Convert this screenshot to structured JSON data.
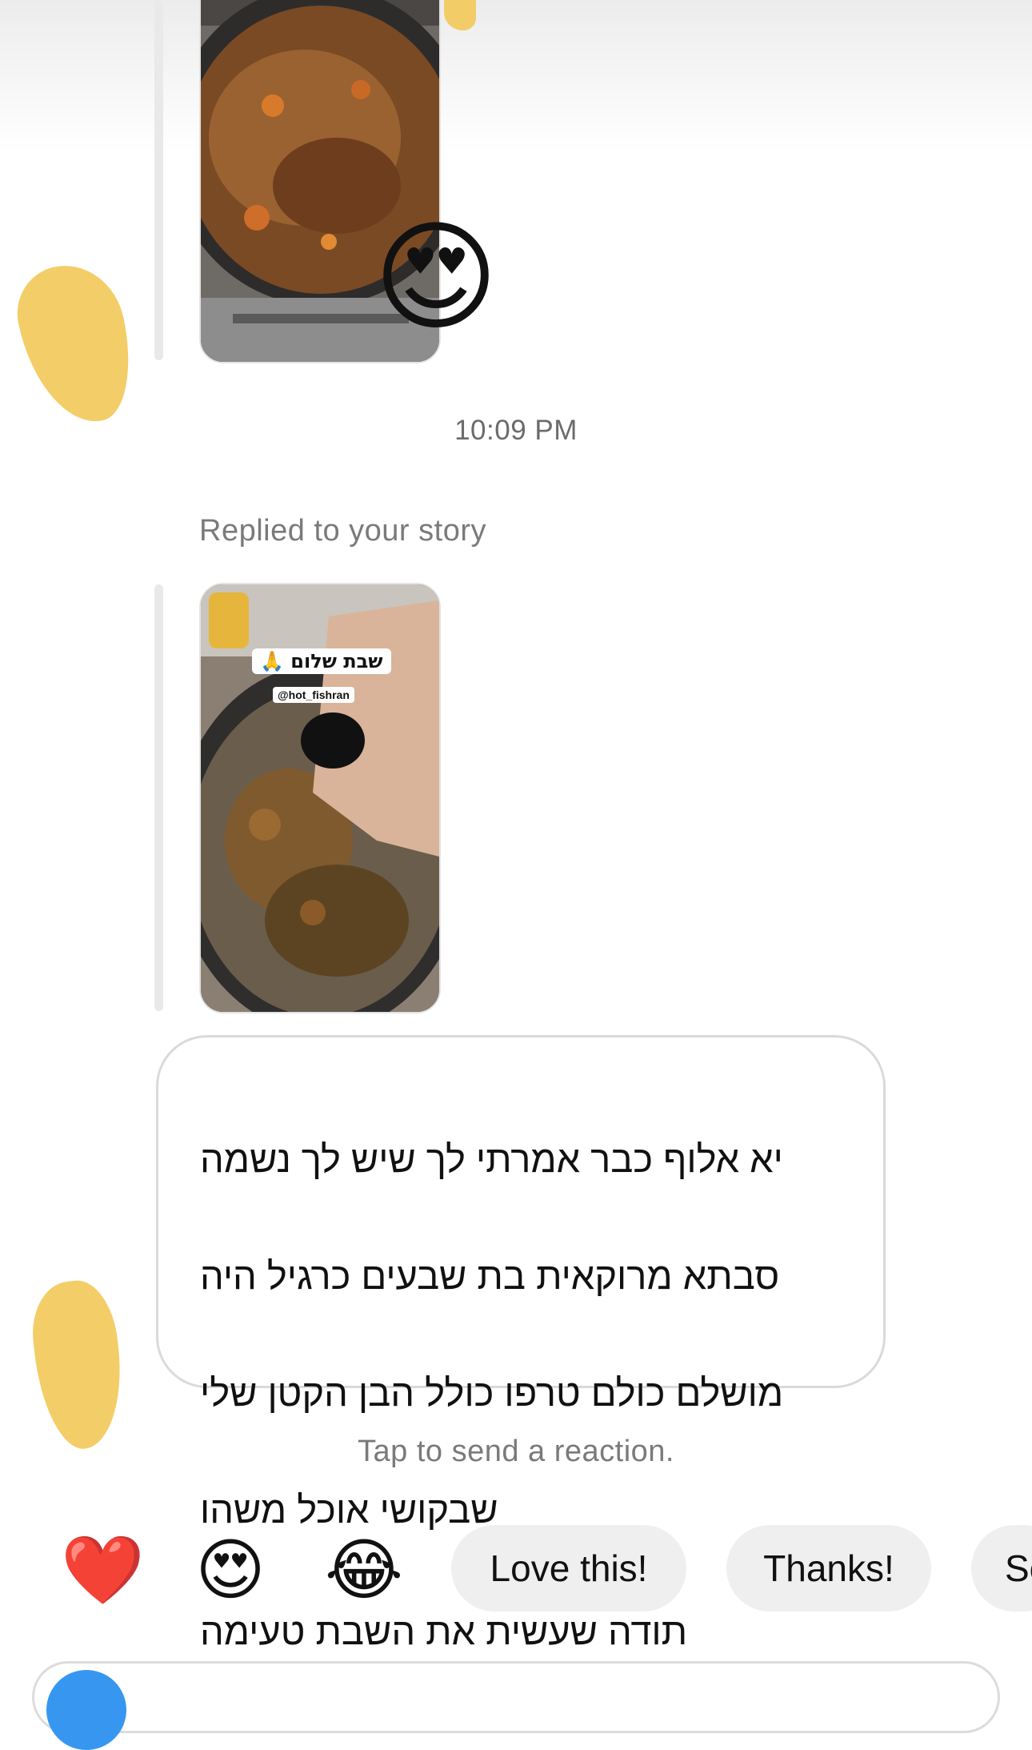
{
  "thread": {
    "timestamp": "10:09 PM",
    "replied_label": "Replied to your story",
    "reaction_on_photo": "😍",
    "story_sticker": "שבת שלום 🙏",
    "story_handle": "@hot_fishran"
  },
  "message": {
    "lines": [
      "יא אלוף כבר אמרתי לך שיש לך נשמה",
      "סבתא מרוקאית בת שבעים כרגיל היה",
      "מושלם כולם טרפו כולל הבן הקטן שלי",
      "שבקושי אוכל משהו",
      "תודה שעשית את השבת טעימה"
    ]
  },
  "reactions": {
    "hint": "Tap to send a reaction.",
    "emojis": [
      {
        "glyph": "❤️",
        "icon": "heart-icon"
      },
      {
        "glyph": "😍",
        "icon": "heart-eyes-icon"
      },
      {
        "glyph": "😂",
        "icon": "tears-of-joy-icon"
      }
    ],
    "chips": [
      "Love this!",
      "Thanks!",
      "Se"
    ]
  },
  "colors": {
    "accent": "#3797f0",
    "bubble_border": "#dadada",
    "chip_bg": "#efefef",
    "redaction": "#f2c95a"
  }
}
